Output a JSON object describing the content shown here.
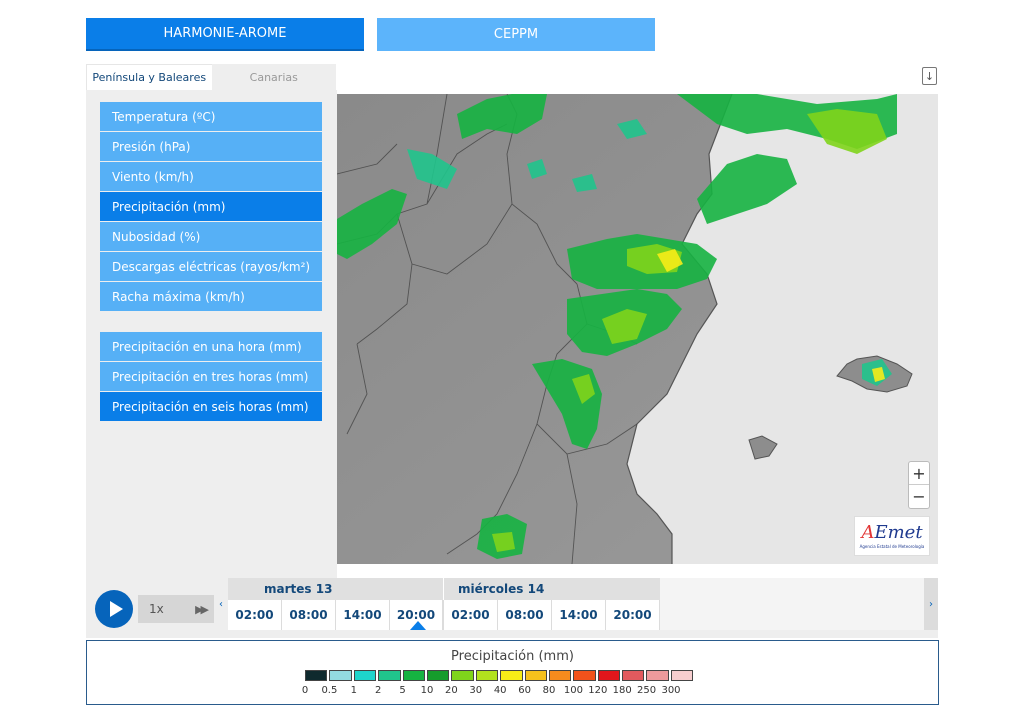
{
  "models": {
    "active": "HARMONIE-AROME",
    "other": "CEPPM"
  },
  "regions": {
    "active": "Península y Baleares",
    "other": "Canarias"
  },
  "variables": [
    {
      "label": "Temperatura (ºC)",
      "active": false
    },
    {
      "label": "Presión (hPa)",
      "active": false
    },
    {
      "label": "Viento (km/h)",
      "active": false
    },
    {
      "label": "Precipitación (mm)",
      "active": true
    },
    {
      "label": "Nubosidad (%)",
      "active": false
    },
    {
      "label": "Descargas eléctricas (rayos/km²)",
      "active": false
    },
    {
      "label": "Racha máxima (km/h)",
      "active": false
    }
  ],
  "accumulations": [
    {
      "label": "Precipitación en una hora (mm)",
      "active": false
    },
    {
      "label": "Precipitación en tres horas (mm)",
      "active": false
    },
    {
      "label": "Precipitación en seis horas (mm)",
      "active": true
    }
  ],
  "map": {
    "zoom_in": "+",
    "zoom_out": "−",
    "logo_text": "AEmet",
    "logo_sub": "Agencia Estatal de Meteorología"
  },
  "timeline": {
    "speed": "1x",
    "days": [
      "martes 13",
      "miércoles 14"
    ],
    "hours": [
      "02:00",
      "08:00",
      "14:00",
      "20:00",
      "02:00",
      "08:00",
      "14:00",
      "20:00"
    ],
    "selected_hour_index": 3
  },
  "legend": {
    "title": "Precipitación (mm)",
    "colors": [
      "#0f2a2e",
      "#93dbe0",
      "#1ed5cc",
      "#20c48c",
      "#16b341",
      "#169c2c",
      "#7fd41b",
      "#b2e21e",
      "#f7ec17",
      "#f6c11c",
      "#f68b1d",
      "#f2521b",
      "#e2161b",
      "#e25a5e",
      "#ee9a9c",
      "#f7cecf"
    ],
    "ticks": [
      "0",
      "0.5",
      "1",
      "2",
      "5",
      "10",
      "20",
      "30",
      "40",
      "60",
      "80",
      "100",
      "120",
      "180",
      "250",
      "300"
    ]
  }
}
